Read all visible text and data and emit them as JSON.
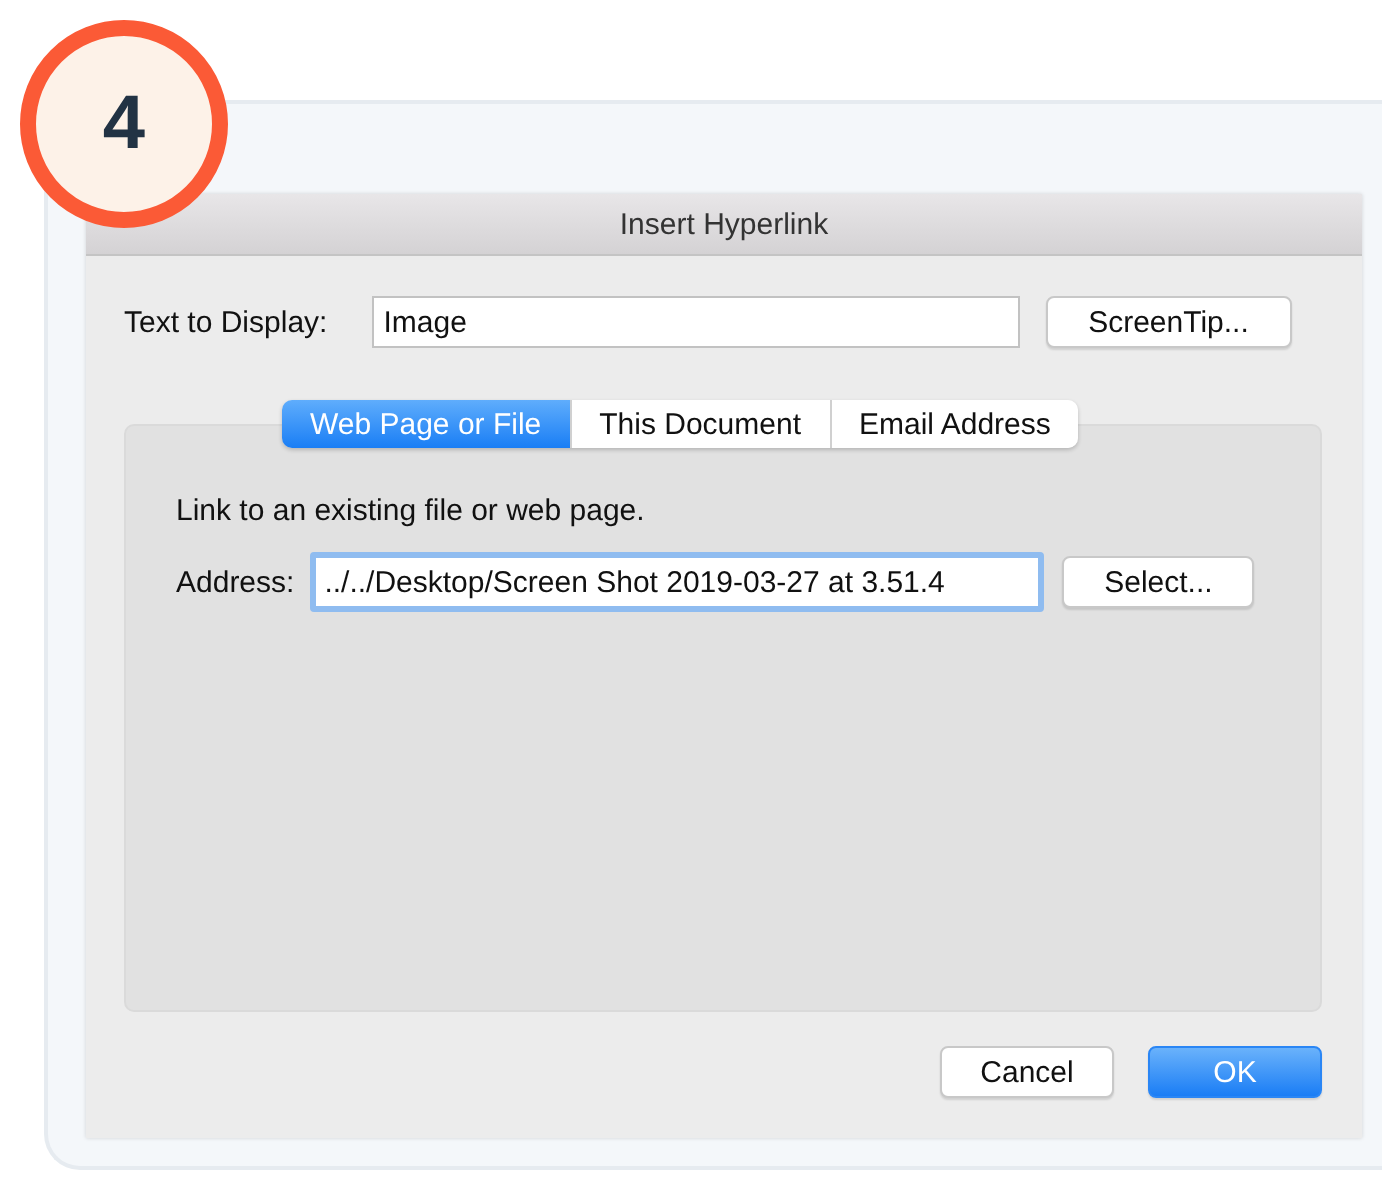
{
  "step_badge": "4",
  "window": {
    "title": "Insert Hyperlink"
  },
  "text_to_display": {
    "label": "Text to Display:",
    "value": "Image"
  },
  "screentip_button": "ScreenTip...",
  "tabs": [
    {
      "label": "Web Page or File",
      "selected": true
    },
    {
      "label": "This Document",
      "selected": false
    },
    {
      "label": "Email Address",
      "selected": false
    }
  ],
  "panel": {
    "description": "Link to an existing file or web page.",
    "address_label": "Address:",
    "address_value": "../../Desktop/Screen Shot 2019-03-27 at 3.51.4",
    "select_button": "Select..."
  },
  "buttons": [
    {
      "label": "Cancel",
      "kind": "secondary"
    },
    {
      "label": "OK",
      "kind": "primary"
    }
  ]
}
